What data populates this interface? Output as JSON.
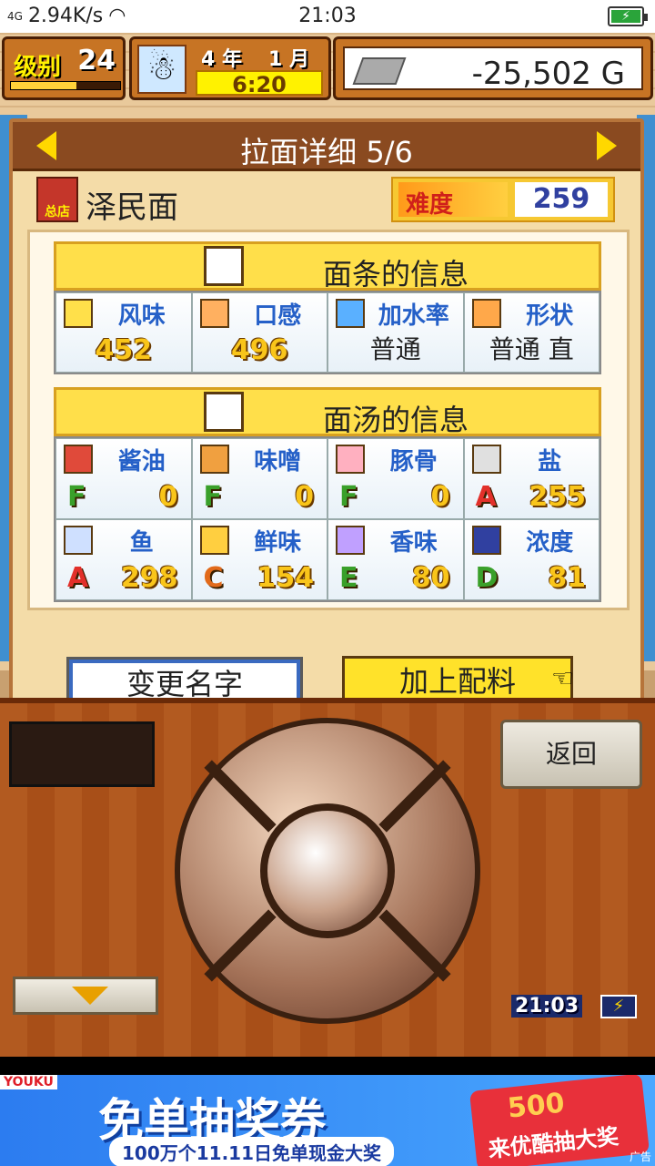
{
  "status_bar": {
    "signal": "4G",
    "net_speed": "2.94K/s",
    "time": "21:03",
    "battery": "⚡"
  },
  "hud": {
    "level_label": "级别",
    "level_value": "24",
    "level_progress": 0.6,
    "year": "4 年",
    "month": "1 月",
    "time": "6:20",
    "money": "-25,502 G"
  },
  "panel": {
    "title": "拉面详细 5/6",
    "shop_tag": "总店",
    "ramen_name": "泽民面",
    "difficulty_label": "难度",
    "difficulty_value": "259",
    "noodle_section": "面条的信息",
    "noodle": [
      {
        "name": "风味",
        "value": "452",
        "big": true
      },
      {
        "name": "口感",
        "value": "496",
        "big": true
      },
      {
        "name": "加水率",
        "value": "普通",
        "big": false
      },
      {
        "name": "形状",
        "value": "普通 直",
        "big": false
      }
    ],
    "soup_section": "面汤的信息",
    "soup": [
      {
        "name": "酱油",
        "grade": "F",
        "value": "0",
        "grade_color": "#3aa02a"
      },
      {
        "name": "味噌",
        "grade": "F",
        "value": "0",
        "grade_color": "#3aa02a"
      },
      {
        "name": "豚骨",
        "grade": "F",
        "value": "0",
        "grade_color": "#3aa02a"
      },
      {
        "name": "盐",
        "grade": "A",
        "value": "255",
        "grade_color": "#e2302a"
      },
      {
        "name": "鱼",
        "grade": "A",
        "value": "298",
        "grade_color": "#e2302a"
      },
      {
        "name": "鲜味",
        "grade": "C",
        "value": "154",
        "grade_color": "#e26a1a"
      },
      {
        "name": "香味",
        "grade": "E",
        "value": "80",
        "grade_color": "#3aa02a"
      },
      {
        "name": "浓度",
        "grade": "D",
        "value": "81",
        "grade_color": "#3aa02a"
      }
    ],
    "rename_button": "变更名字",
    "add_button": "加上配料"
  },
  "controls": {
    "back_button": "返回",
    "clock": "21:03"
  },
  "ad": {
    "brand": "YOUKU",
    "headline": "免单抽奖券",
    "sub": "100万个11.11日免单现金大奖",
    "coupon_num": "500",
    "coupon_text": "来优酷抽大奖",
    "tag": "广告"
  }
}
